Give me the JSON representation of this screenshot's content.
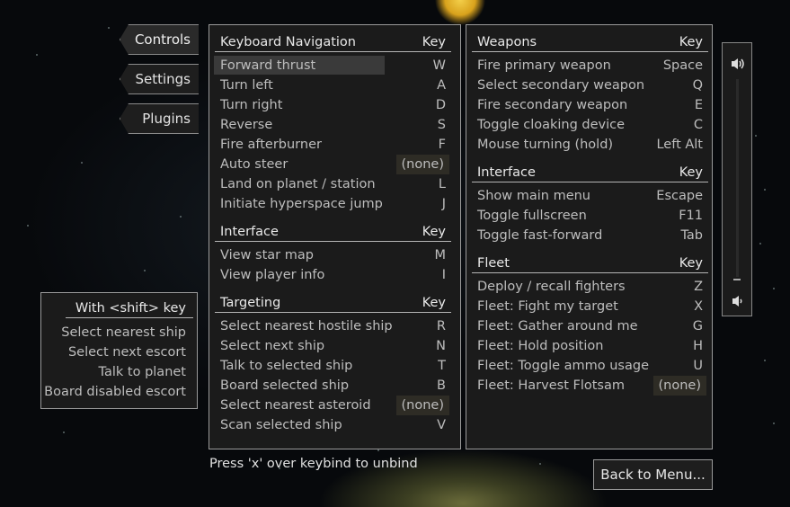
{
  "tabs": [
    {
      "label": "Controls",
      "active": true
    },
    {
      "label": "Settings",
      "active": false
    },
    {
      "label": "Plugins",
      "active": false
    }
  ],
  "left": {
    "sections": [
      {
        "title": "Keyboard Navigation",
        "key": "Key",
        "rows": [
          {
            "label": "Forward thrust",
            "bind": "W"
          },
          {
            "label": "Turn left",
            "bind": "A"
          },
          {
            "label": "Turn right",
            "bind": "D"
          },
          {
            "label": "Reverse",
            "bind": "S"
          },
          {
            "label": "Fire afterburner",
            "bind": "F"
          },
          {
            "label": "Auto steer",
            "bind": "(none)"
          },
          {
            "label": "Land on planet / station",
            "bind": "L"
          },
          {
            "label": "Initiate hyperspace jump",
            "bind": "J"
          }
        ]
      },
      {
        "title": "Interface",
        "key": "Key",
        "rows": [
          {
            "label": "View star map",
            "bind": "M"
          },
          {
            "label": "View player info",
            "bind": "I"
          }
        ]
      },
      {
        "title": "Targeting",
        "key": "Key",
        "rows": [
          {
            "label": "Select nearest hostile ship",
            "bind": "R"
          },
          {
            "label": "Select next ship",
            "bind": "N"
          },
          {
            "label": "Talk to selected ship",
            "bind": "T"
          },
          {
            "label": "Board selected ship",
            "bind": "B"
          },
          {
            "label": "Select nearest asteroid",
            "bind": "(none)"
          },
          {
            "label": "Scan selected ship",
            "bind": "V"
          }
        ]
      }
    ]
  },
  "right": {
    "sections": [
      {
        "title": "Weapons",
        "key": "Key",
        "rows": [
          {
            "label": "Fire primary weapon",
            "bind": "Space"
          },
          {
            "label": "Select secondary weapon",
            "bind": "Q"
          },
          {
            "label": "Fire secondary weapon",
            "bind": "E"
          },
          {
            "label": "Toggle cloaking device",
            "bind": "C"
          },
          {
            "label": "Mouse turning (hold)",
            "bind": "Left Alt"
          }
        ]
      },
      {
        "title": "Interface",
        "key": "Key",
        "rows": [
          {
            "label": "Show main menu",
            "bind": "Escape"
          },
          {
            "label": "Toggle fullscreen",
            "bind": "F11"
          },
          {
            "label": "Toggle fast-forward",
            "bind": "Tab"
          }
        ]
      },
      {
        "title": "Fleet",
        "key": "Key",
        "rows": [
          {
            "label": "Deploy / recall fighters",
            "bind": "Z"
          },
          {
            "label": "Fleet: Fight my target",
            "bind": "X"
          },
          {
            "label": "Fleet: Gather around me",
            "bind": "G"
          },
          {
            "label": "Fleet: Hold position",
            "bind": "H"
          },
          {
            "label": "Fleet: Toggle ammo usage",
            "bind": "U"
          },
          {
            "label": "Fleet: Harvest Flotsam",
            "bind": "(none)"
          }
        ]
      }
    ]
  },
  "shift": {
    "title": "With <shift> key",
    "items": [
      "Select nearest ship",
      "Select next escort",
      "Talk to planet",
      "Board disabled escort"
    ]
  },
  "footer": {
    "hint": "Press 'x' over keybind to unbind",
    "back": "Back to Menu..."
  },
  "volume": {
    "level": 0.0
  },
  "icons": {
    "volume_max": "speaker-loud-icon",
    "volume_min": "speaker-quiet-icon"
  }
}
